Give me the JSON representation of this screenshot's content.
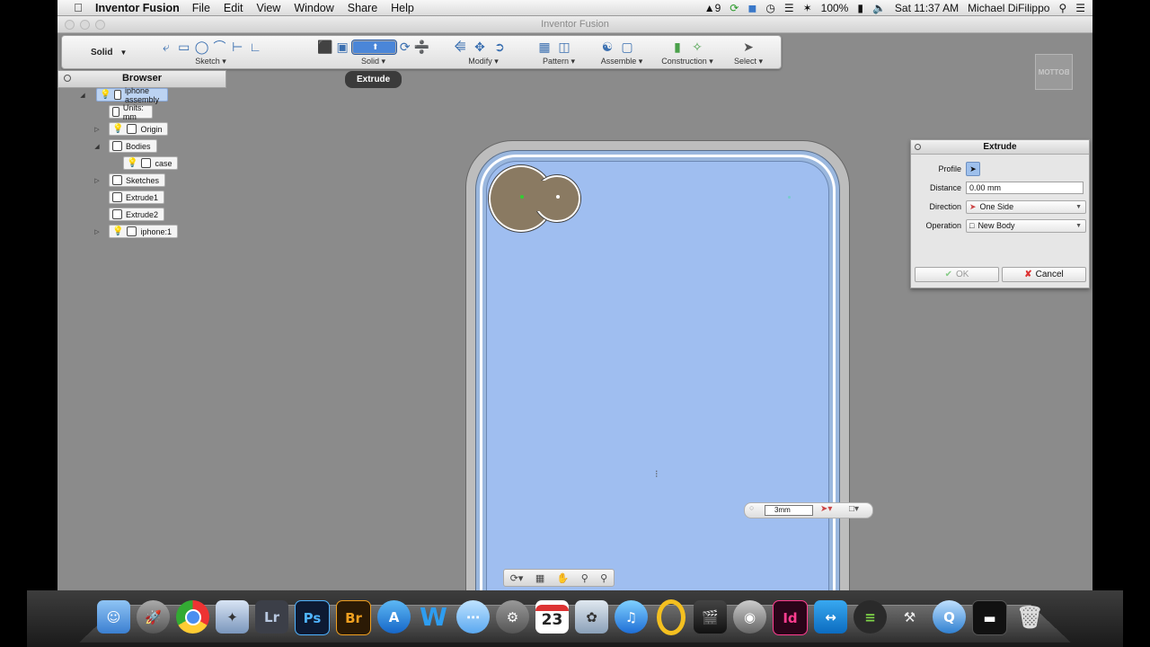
{
  "menubar": {
    "app_name": "Inventor Fusion",
    "items": [
      "File",
      "Edit",
      "View",
      "Window",
      "Share",
      "Help"
    ],
    "status": {
      "adobe_badge": "9",
      "battery": "100%",
      "clock": "Sat 11:37 AM",
      "user": "Michael DiFilippo"
    }
  },
  "window": {
    "title": "Inventor Fusion"
  },
  "ribbon": {
    "mode_label": "Solid",
    "groups": [
      {
        "label": "Sketch"
      },
      {
        "label": "Solid"
      },
      {
        "label": "Modify"
      },
      {
        "label": "Pattern"
      },
      {
        "label": "Assemble"
      },
      {
        "label": "Construction"
      },
      {
        "label": "Select"
      }
    ],
    "tooltip": "Extrude"
  },
  "viewcube_label": "BOTTOM",
  "browser": {
    "title": "Browser",
    "nodes": [
      {
        "label": "iphone assembly"
      },
      {
        "label": "Units: mm"
      },
      {
        "label": "Origin"
      },
      {
        "label": "Bodies"
      },
      {
        "label": "case"
      },
      {
        "label": "Sketches"
      },
      {
        "label": "Extrude1"
      },
      {
        "label": "Extrude2"
      },
      {
        "label": "iphone:1"
      }
    ]
  },
  "extrude_dialog": {
    "title": "Extrude",
    "profile_label": "Profile",
    "distance_label": "Distance",
    "distance_value": "0.00 mm",
    "direction_label": "Direction",
    "direction_value": "One Side",
    "operation_label": "Operation",
    "operation_value": "New Body",
    "ok_label": "OK",
    "cancel_label": "Cancel"
  },
  "mini_toolbar": {
    "distance_input": "3mm"
  },
  "dock": {
    "apps": [
      "Finder",
      "Launchpad",
      "Chrome",
      "Preview",
      "Lightroom",
      "Photoshop",
      "Bridge",
      "App Store",
      "Word",
      "Messages",
      "System Preferences",
      "Calendar",
      "iPhoto",
      "iTunes",
      "Outlook",
      "Final Cut",
      "DVD Player",
      "InDesign",
      "TeamViewer",
      "Spotify",
      "Tools",
      "QuickTime",
      "Display",
      "Trash"
    ],
    "labels": {
      "lightroom": "Lr",
      "photoshop": "Ps",
      "bridge": "Br",
      "indesign": "Id",
      "calendar_day": "23"
    }
  }
}
